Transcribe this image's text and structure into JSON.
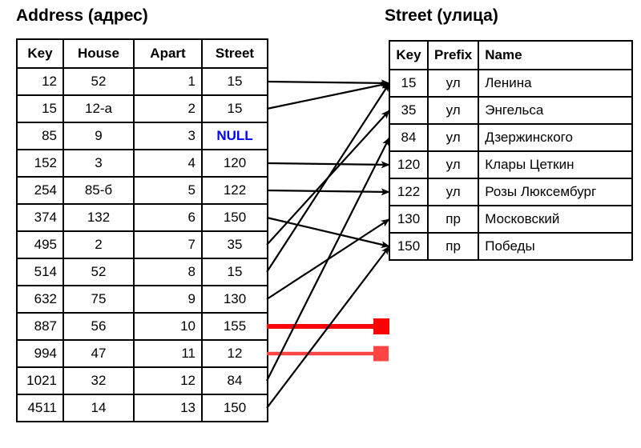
{
  "diagram": {
    "title_left": "Address (адрес)",
    "title_right": "Street (улица)",
    "null_label": "NULL",
    "colors": {
      "line": "#000000",
      "null_text": "#0000FF",
      "broken_link_strong": "#FF0000",
      "broken_link_weak": "#FF4444",
      "table_border": "#000000",
      "background": "#FFFFFF"
    }
  },
  "address_table": {
    "name": "Address (адрес)",
    "headers": [
      "Key",
      "House",
      "Apart",
      "Street"
    ],
    "rows": [
      {
        "key": "12",
        "house": "52",
        "apart": "1",
        "street": "15"
      },
      {
        "key": "15",
        "house": "12-а",
        "apart": "2",
        "street": "15"
      },
      {
        "key": "85",
        "house": "9",
        "apart": "3",
        "street": "NULL"
      },
      {
        "key": "152",
        "house": "3",
        "apart": "4",
        "street": "120"
      },
      {
        "key": "254",
        "house": "85-б",
        "apart": "5",
        "street": "122"
      },
      {
        "key": "374",
        "house": "132",
        "apart": "6",
        "street": "150"
      },
      {
        "key": "495",
        "house": "2",
        "apart": "7",
        "street": "35"
      },
      {
        "key": "514",
        "house": "52",
        "apart": "8",
        "street": "15"
      },
      {
        "key": "632",
        "house": "75",
        "apart": "9",
        "street": "130"
      },
      {
        "key": "887",
        "house": "56",
        "apart": "10",
        "street": "155"
      },
      {
        "key": "994",
        "house": "47",
        "apart": "11",
        "street": "12"
      },
      {
        "key": "1021",
        "house": "32",
        "apart": "12",
        "street": "84"
      },
      {
        "key": "4511",
        "house": "14",
        "apart": "13",
        "street": "150"
      }
    ]
  },
  "street_table": {
    "name": "Street (улица)",
    "headers": [
      "Key",
      "Prefix",
      "Name"
    ],
    "rows": [
      {
        "key": "15",
        "prefix": "ул",
        "name": "Ленина"
      },
      {
        "key": "35",
        "prefix": "ул",
        "name": "Энгельса"
      },
      {
        "key": "84",
        "prefix": "ул",
        "name": "Дзержинского"
      },
      {
        "key": "120",
        "prefix": "ул",
        "name": "Клары Цеткин"
      },
      {
        "key": "122",
        "prefix": "ул",
        "name": "Розы Люксембург"
      },
      {
        "key": "130",
        "prefix": "пр",
        "name": "Московский"
      },
      {
        "key": "150",
        "prefix": "пр",
        "name": "Победы"
      }
    ]
  },
  "links": [
    {
      "from_row": 0,
      "from_value": "15",
      "to_row": 0,
      "to_value": "15",
      "kind": "resolved"
    },
    {
      "from_row": 1,
      "from_value": "15",
      "to_row": 0,
      "to_value": "15",
      "kind": "resolved"
    },
    {
      "from_row": 3,
      "from_value": "120",
      "to_row": 3,
      "to_value": "120",
      "kind": "resolved"
    },
    {
      "from_row": 4,
      "from_value": "122",
      "to_row": 4,
      "to_value": "122",
      "kind": "resolved"
    },
    {
      "from_row": 5,
      "from_value": "150",
      "to_row": 6,
      "to_value": "150",
      "kind": "resolved"
    },
    {
      "from_row": 6,
      "from_value": "35",
      "to_row": 1,
      "to_value": "35",
      "kind": "resolved"
    },
    {
      "from_row": 7,
      "from_value": "15",
      "to_row": 0,
      "to_value": "15",
      "kind": "resolved"
    },
    {
      "from_row": 8,
      "from_value": "130",
      "to_row": 5,
      "to_value": "130",
      "kind": "resolved"
    },
    {
      "from_row": 9,
      "from_value": "155",
      "to_row": null,
      "to_value": null,
      "kind": "broken-strong"
    },
    {
      "from_row": 10,
      "from_value": "12",
      "to_row": null,
      "to_value": null,
      "kind": "broken-weak"
    },
    {
      "from_row": 11,
      "from_value": "84",
      "to_row": 2,
      "to_value": "84",
      "kind": "resolved"
    },
    {
      "from_row": 12,
      "from_value": "150",
      "to_row": 6,
      "to_value": "150",
      "kind": "resolved"
    }
  ]
}
